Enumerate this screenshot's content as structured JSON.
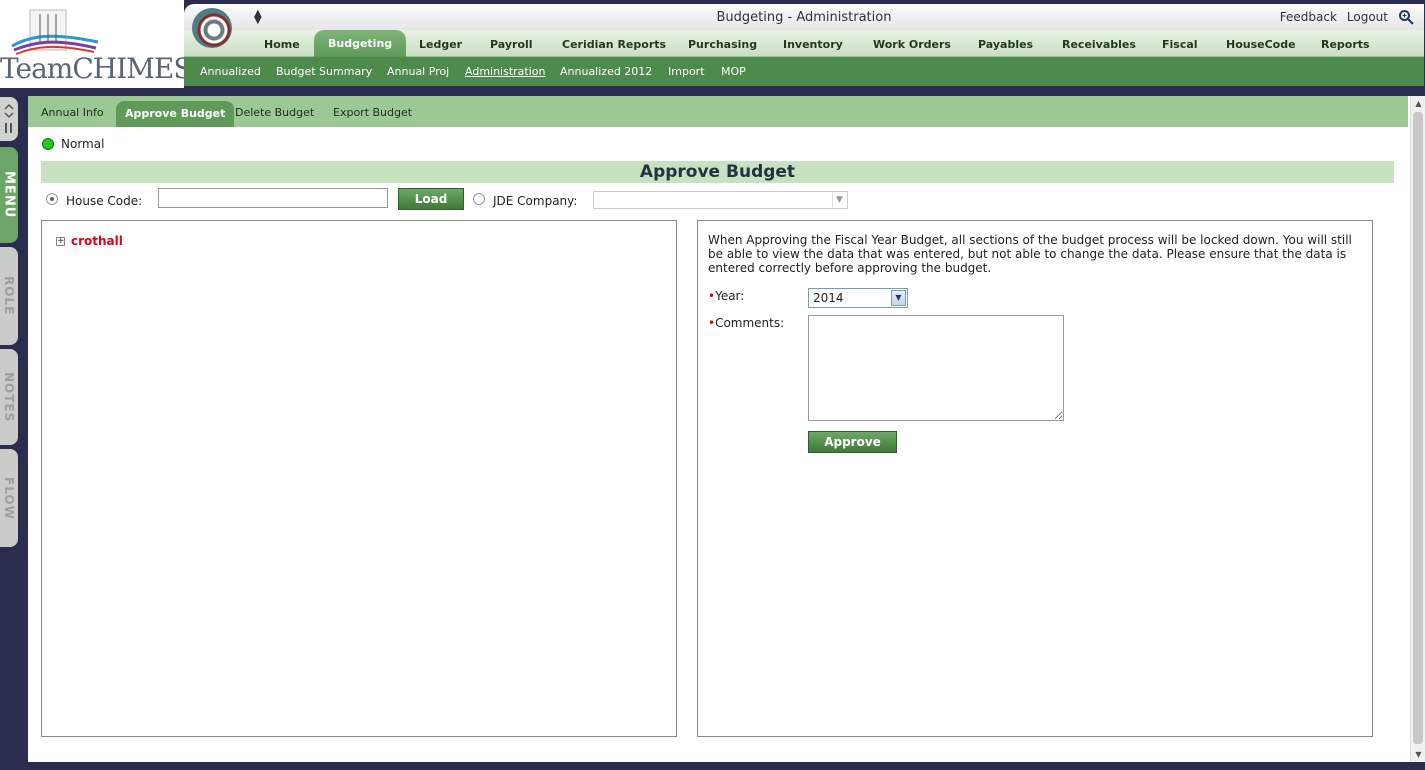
{
  "logo": {
    "word": "TeamCHIMES"
  },
  "header": {
    "app_title": "Budgeting - Administration",
    "links": {
      "feedback": "Feedback",
      "logout": "Logout",
      "search_icon": "magnifier-icon"
    }
  },
  "mainnav": {
    "tabs": [
      "Home",
      "Budgeting",
      "Ledger",
      "Payroll",
      "Ceridian Reports",
      "Purchasing",
      "Inventory",
      "Work Orders",
      "Payables",
      "Receivables",
      "Fiscal",
      "HouseCode",
      "Reports"
    ],
    "active": "Budgeting"
  },
  "subnav": {
    "items": [
      "Annualized",
      "Budget Summary",
      "Annual Proj",
      "Administration",
      "Annualized 2012",
      "Import",
      "MOP"
    ],
    "active": "Administration"
  },
  "sidetabs": [
    "MENU",
    "ROLE",
    "NOTES",
    "FLOW"
  ],
  "content_tabs": {
    "items": [
      "Annual Info",
      "Approve Budget",
      "Delete Budget",
      "Export Budget"
    ],
    "active": "Approve Budget"
  },
  "status": {
    "label": "Normal",
    "color": "#1fcc1f"
  },
  "section_title": "Approve Budget",
  "selector": {
    "house_code_label": "House Code:",
    "house_code_value": "",
    "load_label": "Load",
    "jde_label": "JDE Company:",
    "jde_value": "",
    "selected": "house_code"
  },
  "tree": {
    "root": "crothall"
  },
  "form": {
    "info": "When Approving the Fiscal Year Budget, all sections of the budget process will be locked down. You will still be able to view the data that was entered, but not able to change the data. Please ensure that the data is entered correctly before approving the budget.",
    "required_mark": "•",
    "year_label": "Year:",
    "year_value": "2014",
    "comments_label": "Comments:",
    "comments_value": "",
    "approve_label": "Approve"
  },
  "colors": {
    "accent_green": "#5f9a58",
    "background": "#2b2d4f",
    "tree_root": "#e0001a"
  }
}
